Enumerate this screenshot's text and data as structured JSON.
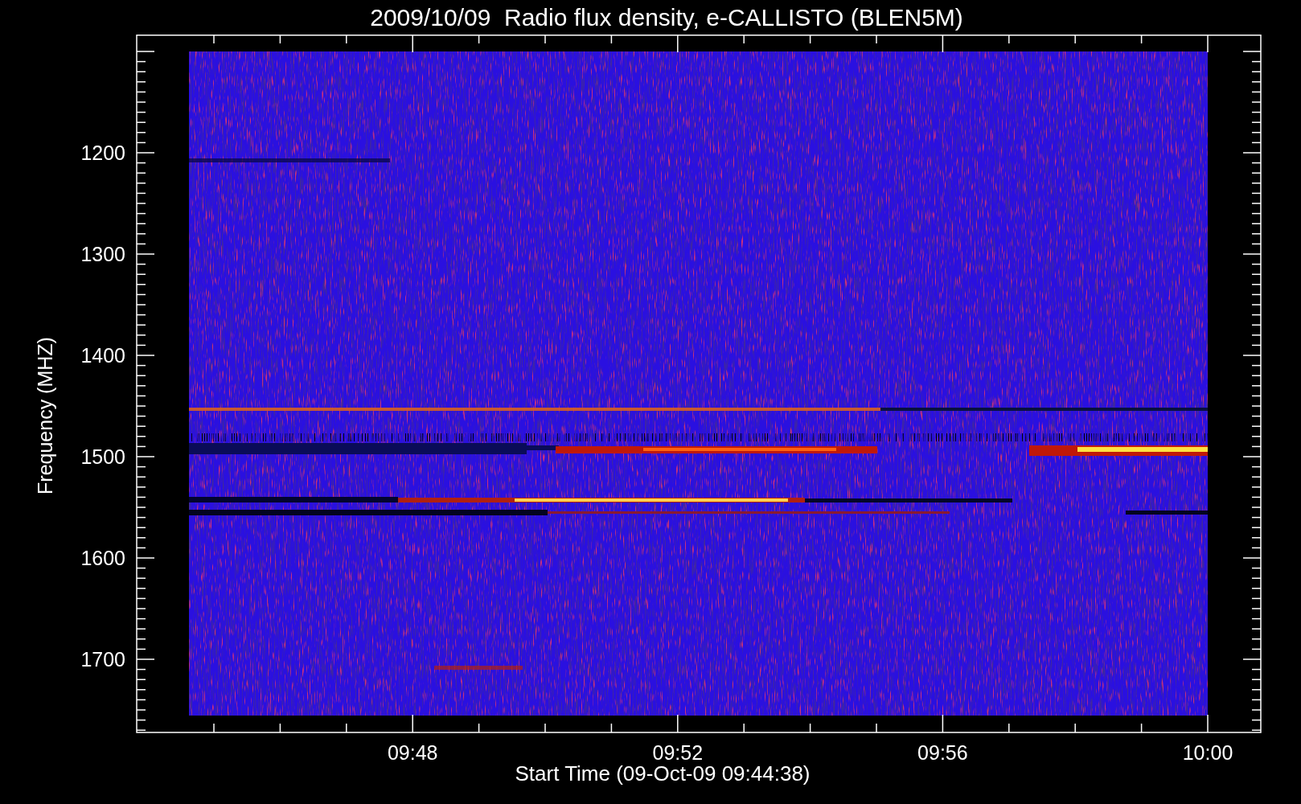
{
  "title": "2009/10/09  Radio flux density, e-CALLISTO (BLEN5M)",
  "ylabel": "Frequency (MHZ)",
  "xlabel": "Start Time (09-Oct-09 09:44:38)",
  "yticks": [
    "1200",
    "1300",
    "1400",
    "1500",
    "1600",
    "1700"
  ],
  "xticks": [
    "09:48",
    "09:52",
    "09:56",
    "10:00"
  ]
}
